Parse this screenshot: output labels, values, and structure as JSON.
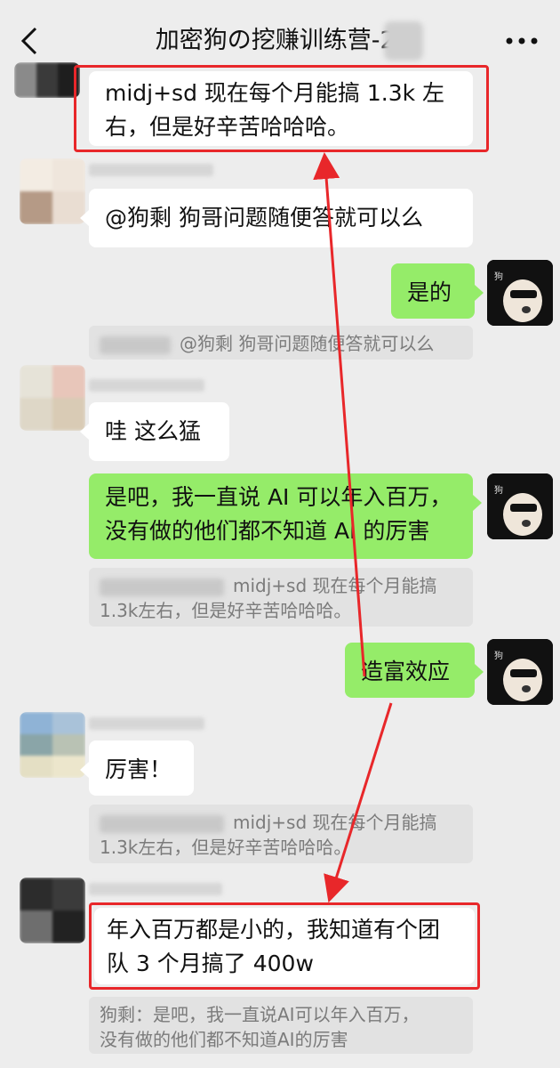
{
  "header": {
    "title": "加密狗の挖赚训练营-2(",
    "back_icon": "chevron-left-icon",
    "more_icon": "more-dots-icon"
  },
  "colors": {
    "background": "#ededed",
    "incoming_bubble": "#ffffff",
    "outgoing_bubble": "#95ec69",
    "quote_bg": "#e2e2e2",
    "highlight_box": "#e8272a",
    "arrow": "#e8272a"
  },
  "messages": [
    {
      "id": "m1",
      "direction": "incoming",
      "text_line1": "midj+sd  现在每个月能搞  1.3k  左",
      "text_line2": "右，但是好辛苦哈哈哈。",
      "highlighted": true
    },
    {
      "id": "m2",
      "direction": "incoming",
      "text": "@狗剩   狗哥问题随便答就可以么"
    },
    {
      "id": "m3",
      "direction": "outgoing",
      "text": "是的"
    },
    {
      "id": "q1",
      "type": "quote",
      "text": "@狗剩 狗哥问题随便答就可以么"
    },
    {
      "id": "m4",
      "direction": "incoming",
      "text": "哇  这么猛"
    },
    {
      "id": "m5",
      "direction": "outgoing",
      "text_line1": "是吧，我一直说 AI 可以年入百万，",
      "text_line2": "没有做的他们都不知道 AI 的厉害"
    },
    {
      "id": "q2",
      "type": "quote",
      "text_line1": "midj+sd  现在每个月能搞",
      "text_line2": "1.3k左右，但是好辛苦哈哈哈。"
    },
    {
      "id": "m6",
      "direction": "outgoing",
      "text": "造富效应"
    },
    {
      "id": "m7",
      "direction": "incoming",
      "text": "厉害！"
    },
    {
      "id": "q3",
      "type": "quote",
      "text_line1": "midj+sd  现在每个月能搞",
      "text_line2": "1.3k左右，但是好辛苦哈哈哈。"
    },
    {
      "id": "m8",
      "direction": "incoming",
      "text_line1": "年入百万都是小的，我知道有个团",
      "text_line2": "队 3 个月搞了  400w",
      "highlighted": true
    },
    {
      "id": "q4",
      "type": "quote",
      "text_line1": "狗剩：是吧，我一直说AI可以年入百万，",
      "text_line2": "没有做的他们都不知道AI的厉害"
    }
  ],
  "avatar_caption": "狗"
}
